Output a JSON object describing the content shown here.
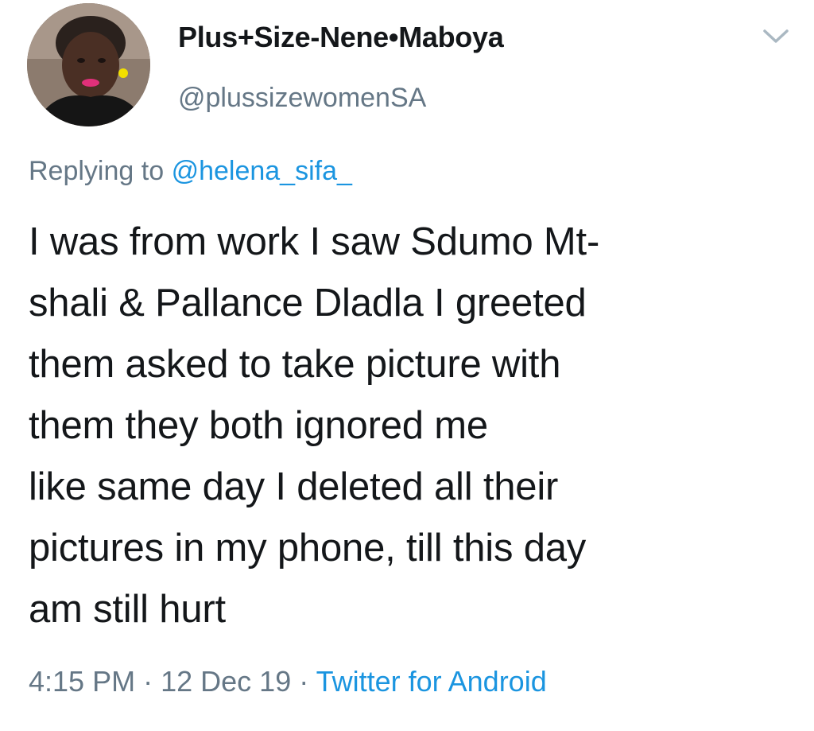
{
  "author": {
    "display_name": "Plus+Size-Nene•Maboya",
    "handle": "@plussizewomenSA",
    "avatar_icon": "profile-photo"
  },
  "menu": {
    "icon": "chevron-down-icon"
  },
  "reply": {
    "prefix": "Replying to",
    "mention": "@helena_sifa_"
  },
  "tweet": {
    "lines": [
      "I was from work I saw Sdumo Mt-",
      "shali & Pallance Dladla I greeted",
      "them asked to take picture with",
      "them they both ignored me",
      "like same day I deleted all their",
      "pictures in my phone, till this day",
      "am still hurt"
    ]
  },
  "meta": {
    "time": "4:15 PM",
    "separator": "·",
    "date": "12 Dec 19",
    "source": "Twitter for Android"
  },
  "colors": {
    "text": "#14171a",
    "secondary": "#657786",
    "link": "#1b95e0"
  }
}
